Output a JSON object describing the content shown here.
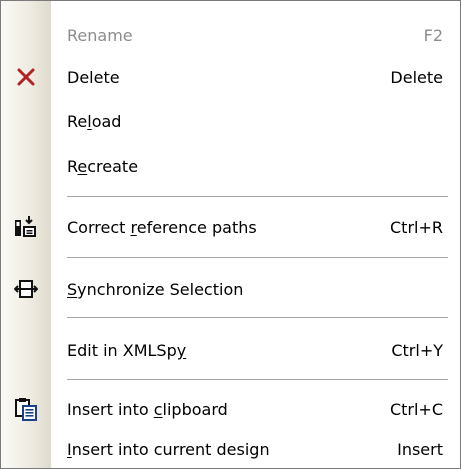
{
  "menu": {
    "items": [
      {
        "label": "Rename",
        "shortcut": "F2",
        "icon": "none",
        "disabled": true
      },
      {
        "label": "Delete",
        "shortcut": "Delete",
        "icon": "delete-x-icon"
      },
      {
        "label": "Reload",
        "shortcut": "",
        "icon": "none",
        "underline": "l"
      },
      {
        "label": "Recreate",
        "shortcut": "",
        "icon": "none",
        "underline": "e"
      },
      {
        "label": "Correct reference paths",
        "shortcut": "Ctrl+R",
        "icon": "correct-paths-icon",
        "underline": "r"
      },
      {
        "label": "Synchronize Selection",
        "shortcut": "",
        "icon": "synchronize-icon",
        "underline": "S"
      },
      {
        "label": "Edit in XMLSpy",
        "shortcut": "Ctrl+Y",
        "icon": "none",
        "underline": "y"
      },
      {
        "label": "Insert into clipboard",
        "shortcut": "Ctrl+C",
        "icon": "clipboard-icon",
        "underline": "c"
      },
      {
        "label": "Insert into current design",
        "shortcut": "Insert",
        "icon": "none",
        "underline": "I"
      }
    ]
  },
  "colors": {
    "delete_icon": "#b22222",
    "disabled_text": "#8c8c8c",
    "separator": "#a6a6a6"
  }
}
